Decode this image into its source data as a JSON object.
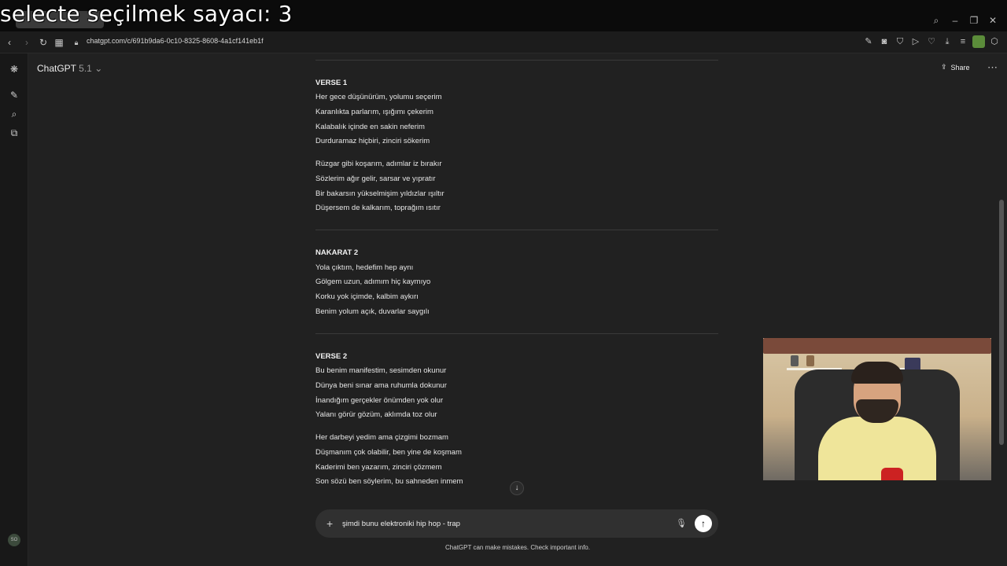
{
  "overlay": {
    "text": "selecte seçilmek sayacı: 3"
  },
  "browser": {
    "tabs": [
      {
        "label": ""
      },
      {
        "label": ""
      }
    ],
    "url": "chatgpt.com/c/691b9da6-0c10-8325-8608-4a1cf141eb1f"
  },
  "app": {
    "model_name": "ChatGPT",
    "model_version": "5.1",
    "share_label": "Share",
    "more_label": "⋯"
  },
  "lyrics": {
    "verse1_heading": "VERSE 1",
    "verse1_lines": [
      "Her gece düşünürüm, yolumu seçerim",
      "Karanlıkta parlarım, ışığımı çekerim",
      "Kalabalık içinde en sakin neferim",
      "Durduramaz hiçbiri, zinciri sökerim",
      "Rüzgar gibi koşarım, adımlar iz bırakır",
      "Sözlerim ağır gelir, sarsar ve yıpratır",
      "Bir bakarsın yükselmişim yıldızlar ışıltır",
      "Düşersem de kalkarım, toprağım ısıtır"
    ],
    "nakarat2_heading": "NAKARAT 2",
    "nakarat2_lines": [
      "Yola çıktım, hedefim hep aynı",
      "Gölgem uzun, adımım hiç kaymıyo",
      "Korku yok içimde, kalbim aykırı",
      "Benim yolum açık, duvarlar saygılı"
    ],
    "verse2_heading": "VERSE 2",
    "verse2_lines": [
      "Bu benim manifestim, sesimden okunur",
      "Dünya beni sınar ama ruhumla dokunur",
      "İnandığım gerçekler önümden yok olur",
      "Yalanı görür gözüm, aklımda toz olur",
      "Her darbeyi yedim ama çizgimi bozmam",
      "Düşmanım çok olabilir, ben yine de koşmam",
      "Kaderimi ben yazarım, zinciri çözmem",
      "Son sözü ben söylerim, bu sahneden inmem"
    ]
  },
  "composer": {
    "input_value": "şimdi bunu elektroniki hip hop - trap",
    "disclaimer": "ChatGPT can make mistakes. Check important info."
  },
  "icons": {
    "back": "back-icon",
    "forward": "forward-icon",
    "reload": "reload-icon",
    "apps": "apps-icon",
    "lock": "lock-icon",
    "search": "search-icon",
    "minimize": "minimize-icon",
    "restore": "restore-icon",
    "close": "close-icon"
  }
}
